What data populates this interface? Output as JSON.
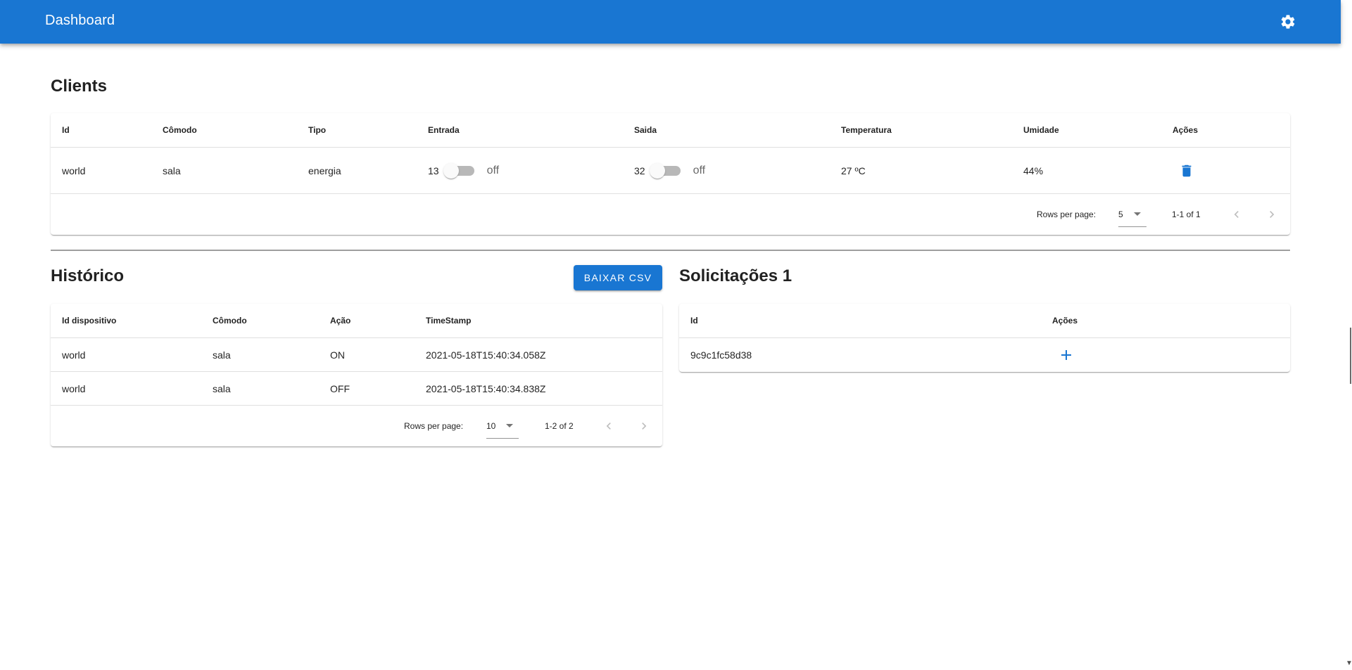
{
  "app": {
    "title": "Dashboard",
    "settings_icon": "gear-icon"
  },
  "colors": {
    "primary": "#1976d2"
  },
  "clients": {
    "title": "Clients",
    "columns": [
      "Id",
      "Cômodo",
      "Tipo",
      "Entrada",
      "Saida",
      "Temperatura",
      "Umidade",
      "Ações"
    ],
    "row": {
      "id": "world",
      "comodo": "sala",
      "tipo": "energia",
      "entrada_value": "13",
      "entrada_state": "off",
      "saida_value": "32",
      "saida_state": "off",
      "temperatura": "27 ºC",
      "umidade": "44%",
      "action_icon": "trash-icon"
    },
    "pagination": {
      "rows_per_page_label": "Rows per page:",
      "rows_per_page": "5",
      "range": "1-1 of 1"
    }
  },
  "historico": {
    "title": "Histórico",
    "download_label": "BAIXAR CSV",
    "columns": [
      "Id dispositivo",
      "Cômodo",
      "Ação",
      "TimeStamp"
    ],
    "rows": [
      [
        "world",
        "sala",
        "ON",
        "2021-05-18T15:40:34.058Z"
      ],
      [
        "world",
        "sala",
        "OFF",
        "2021-05-18T15:40:34.838Z"
      ]
    ],
    "pagination": {
      "rows_per_page_label": "Rows per page:",
      "rows_per_page": "10",
      "range": "1-2 of 2"
    }
  },
  "solicitacoes": {
    "title": "Solicitações 1",
    "columns": [
      "Id",
      "Ações"
    ],
    "rows": [
      {
        "id": "9c9c1fc58d38",
        "action_icon": "plus-icon"
      }
    ]
  }
}
